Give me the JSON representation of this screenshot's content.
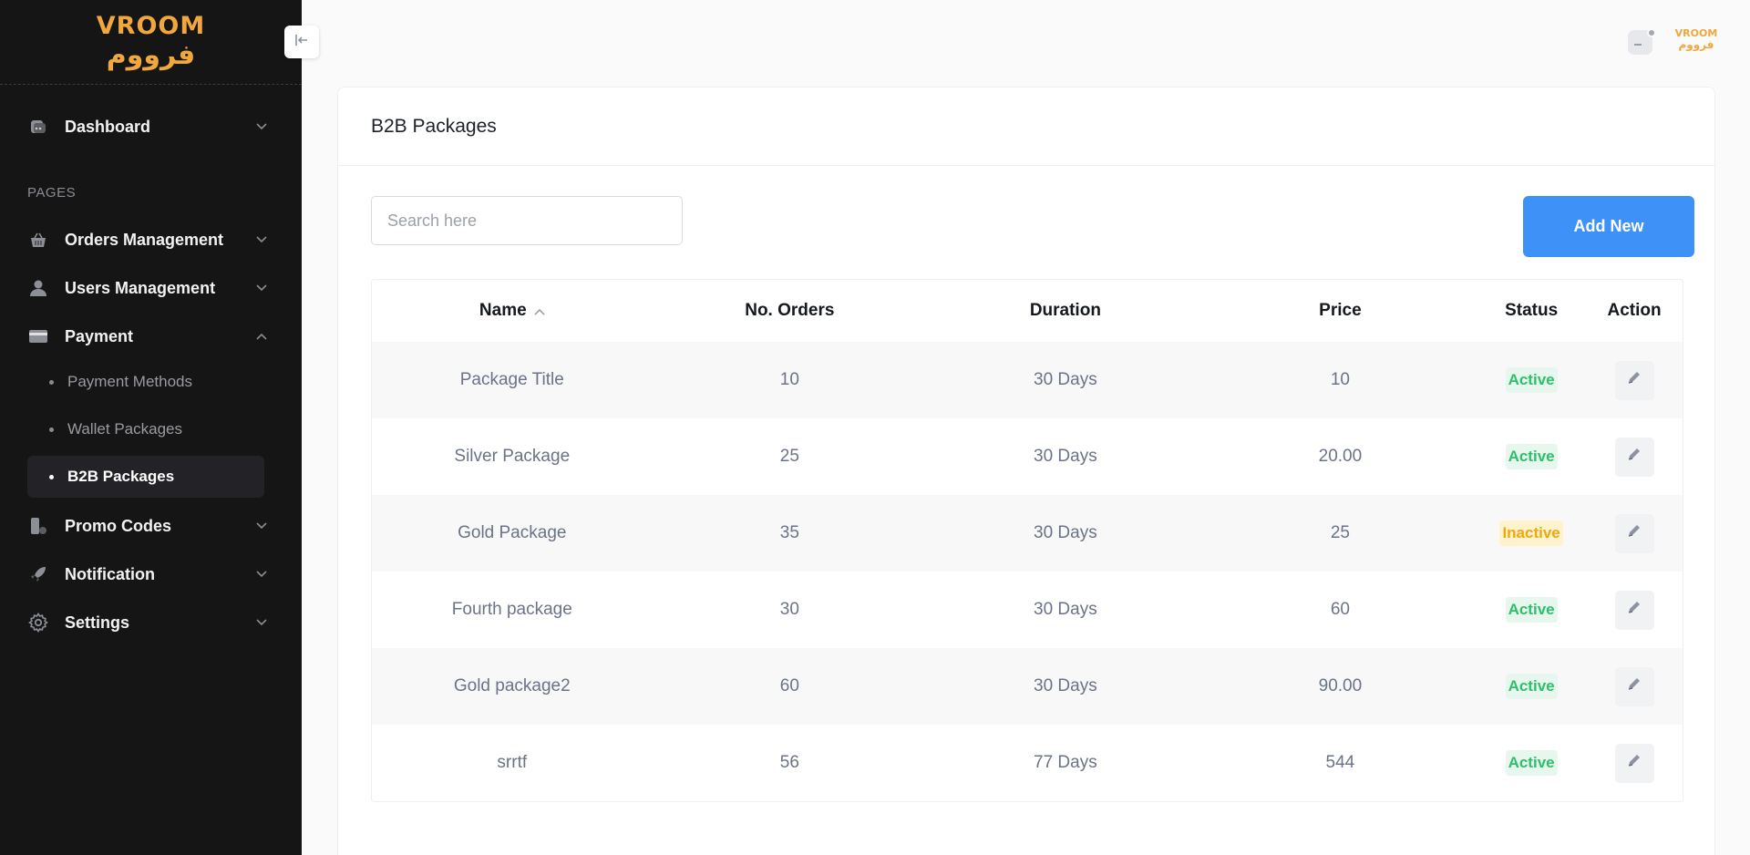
{
  "brand": {
    "en": "VROOM",
    "ar": "فرووم"
  },
  "sidebar": {
    "section_label": "PAGES",
    "items": {
      "dashboard": "Dashboard",
      "orders": "Orders Management",
      "users": "Users Management",
      "payment": "Payment",
      "promo": "Promo Codes",
      "notification": "Notification",
      "settings": "Settings"
    },
    "payment_sub": [
      "Payment Methods",
      "Wallet Packages",
      "B2B Packages"
    ]
  },
  "page": {
    "title": "B2B Packages",
    "search_placeholder": "Search here",
    "add_button": "Add New"
  },
  "table": {
    "columns": [
      "Name",
      "No. Orders",
      "Duration",
      "Price",
      "Status",
      "Action"
    ],
    "rows": [
      {
        "name": "Package Title",
        "orders": "10",
        "duration": "30 Days",
        "price": "10",
        "status": "Active"
      },
      {
        "name": "Silver Package",
        "orders": "25",
        "duration": "30 Days",
        "price": "20.00",
        "status": "Active"
      },
      {
        "name": "Gold Package",
        "orders": "35",
        "duration": "30 Days",
        "price": "25",
        "status": "Inactive"
      },
      {
        "name": "Fourth package",
        "orders": "30",
        "duration": "30 Days",
        "price": "60",
        "status": "Active"
      },
      {
        "name": "Gold package2",
        "orders": "60",
        "duration": "30 Days",
        "price": "90.00",
        "status": "Active"
      },
      {
        "name": "srrtf",
        "orders": "56",
        "duration": "77 Days",
        "price": "544",
        "status": "Active"
      }
    ]
  },
  "colors": {
    "accent": "#3d91f7",
    "brand": "#f0a73c",
    "sidebar_bg": "#151515",
    "active_status": "#2cc06a",
    "inactive_status": "#f0a60c"
  },
  "icons": {
    "collapse": "arrow-left-to-line-icon",
    "edit": "pencil-icon",
    "sort": "chevron-up-icon"
  }
}
